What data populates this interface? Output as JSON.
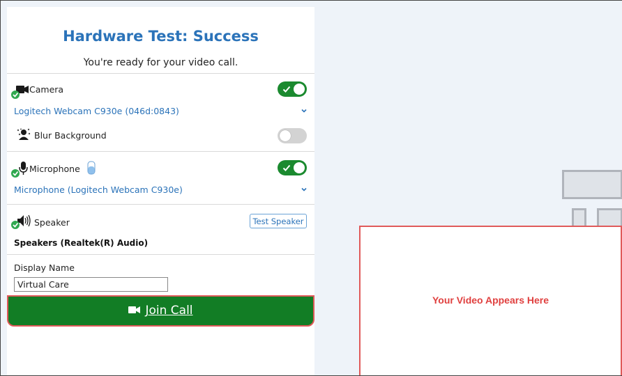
{
  "header": {
    "title": "Hardware Test: Success",
    "subtitle": "You're ready for your video call."
  },
  "camera": {
    "label": "Camera",
    "device": "Logitech Webcam C930e (046d:0843)",
    "enabled": true
  },
  "blur": {
    "label": "Blur Background",
    "enabled": false
  },
  "microphone": {
    "label": "Microphone",
    "device": "Microphone (Logitech Webcam C930e)",
    "enabled": true
  },
  "speaker": {
    "label": "Speaker",
    "test_button": "Test Speaker",
    "device": "Speakers (Realtek(R) Audio)"
  },
  "display_name": {
    "label": "Display Name",
    "value": "Virtual Care"
  },
  "join_button": {
    "label": "Join Call"
  },
  "video_preview": {
    "text": "Your Video Appears Here"
  },
  "colors": {
    "accent": "#2b73b9",
    "success": "#1b8a2f",
    "join": "#127d25",
    "highlight": "#e05a5a"
  }
}
